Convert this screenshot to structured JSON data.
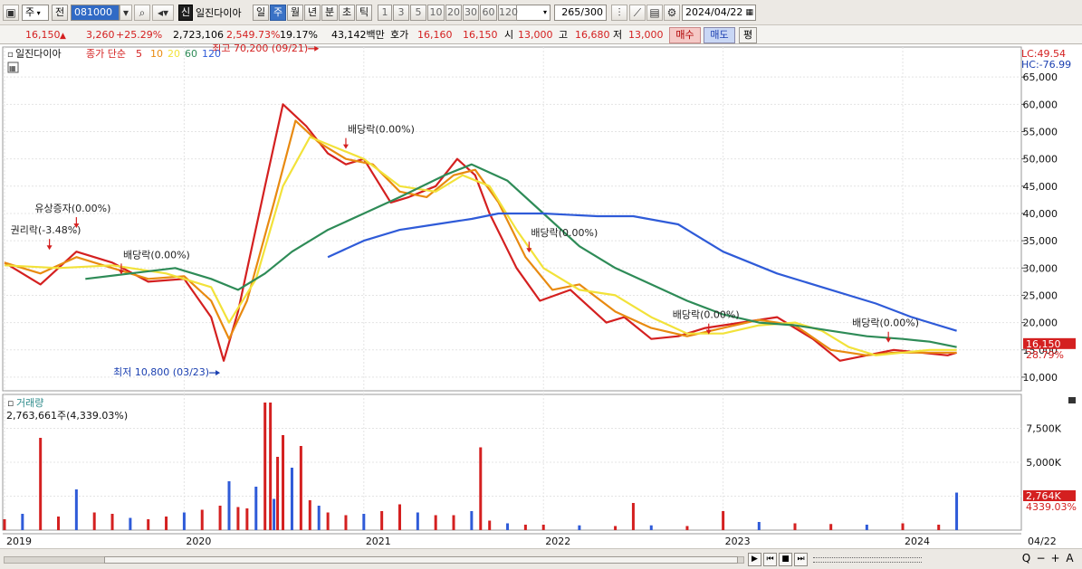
{
  "toolbar": {
    "period_type": "주",
    "mode": "전",
    "code": "081000",
    "stock_name": "일진다이아",
    "new_badge": "신",
    "timeframes": [
      "일",
      "주",
      "월",
      "년",
      "분",
      "초",
      "틱"
    ],
    "active_timeframe": "주",
    "periods": [
      "1",
      "3",
      "5",
      "10",
      "20",
      "30",
      "60",
      "120"
    ],
    "count": "265",
    "count_total": "/300",
    "date": "2024/04/22"
  },
  "quote": {
    "price": "16,150",
    "change": "3,260",
    "change_pct": "+25.29%",
    "volume": "2,723,106",
    "volume_ratio": "2,549.73%",
    "turnover": "19.17%",
    "amount": "43,142백만",
    "ask_label": "호가",
    "ask": "16,160",
    "bid": "16,150",
    "open_label": "시",
    "open": "13,000",
    "high_label": "고",
    "high": "16,680",
    "low_label": "저",
    "low": "13,000",
    "buy_label": "매수",
    "sell_label": "매도",
    "eval_label": "평"
  },
  "chart_data": {
    "type": "line",
    "title": "일진다이아",
    "legend": {
      "price_label": "종가 단순",
      "ma_periods": [
        "5",
        "10",
        "20",
        "60",
        "120"
      ],
      "ma_colors": [
        "#d42020",
        "#e88a10",
        "#f2e23a",
        "#2e8b57",
        "#2f5bd8"
      ]
    },
    "x_labels": [
      "2019",
      "2020",
      "2021",
      "2022",
      "2023",
      "2024",
      "04/22"
    ],
    "y_ticks": [
      "65,000",
      "60,000",
      "55,000",
      "50,000",
      "45,000",
      "40,000",
      "35,000",
      "30,000",
      "25,000",
      "20,000",
      "15,000",
      "10,000"
    ],
    "ylim": [
      7500,
      70500
    ],
    "scale_info": [
      "LC:49.54",
      "HC:-76.99"
    ],
    "current_price_label": "16,150",
    "current_pct_label": "28.79%",
    "series": [
      {
        "name": "5",
        "color": "#d42020",
        "x": [
          2019.0,
          2019.2,
          2019.4,
          2019.6,
          2019.8,
          2020.0,
          2020.15,
          2020.22,
          2020.3,
          2020.45,
          2020.55,
          2020.68,
          2020.8,
          2020.9,
          2021.0,
          2021.15,
          2021.25,
          2021.4,
          2021.52,
          2021.62,
          2021.7,
          2021.85,
          2021.98,
          2022.15,
          2022.35,
          2022.45,
          2022.6,
          2022.75,
          2022.9,
          2023.1,
          2023.3,
          2023.5,
          2023.65,
          2023.8,
          2023.95,
          2024.1,
          2024.25,
          2024.3
        ],
        "values": [
          31000,
          27000,
          33000,
          31000,
          27500,
          28000,
          21000,
          13000,
          22000,
          45000,
          60000,
          56000,
          51000,
          49000,
          50000,
          42000,
          43000,
          45000,
          50000,
          47000,
          40000,
          30000,
          24000,
          26000,
          20000,
          21000,
          17000,
          17500,
          19000,
          20000,
          21000,
          17000,
          13000,
          14000,
          15000,
          14500,
          14000,
          14500
        ]
      },
      {
        "name": "10",
        "color": "#e88a10",
        "x": [
          2019.0,
          2019.2,
          2019.4,
          2019.6,
          2019.8,
          2020.0,
          2020.15,
          2020.25,
          2020.35,
          2020.5,
          2020.62,
          2020.75,
          2020.9,
          2021.05,
          2021.2,
          2021.35,
          2021.5,
          2021.62,
          2021.75,
          2021.9,
          2022.05,
          2022.2,
          2022.4,
          2022.6,
          2022.8,
          2023.0,
          2023.2,
          2023.4,
          2023.6,
          2023.8,
          2023.95,
          2024.1,
          2024.3
        ],
        "values": [
          31000,
          29000,
          32000,
          30000,
          28000,
          28500,
          24000,
          17000,
          24000,
          42000,
          57000,
          53000,
          50000,
          49000,
          44000,
          43000,
          47000,
          48000,
          42000,
          32000,
          26000,
          27000,
          22000,
          19000,
          17500,
          19000,
          20500,
          19500,
          15000,
          14000,
          14500,
          14500,
          14500
        ]
      },
      {
        "name": "20",
        "color": "#f2e23a",
        "x": [
          2019.0,
          2019.3,
          2019.6,
          2019.9,
          2020.15,
          2020.25,
          2020.4,
          2020.55,
          2020.7,
          2020.85,
          2021.0,
          2021.2,
          2021.4,
          2021.55,
          2021.7,
          2021.85,
          2022.0,
          2022.2,
          2022.4,
          2022.6,
          2022.8,
          2023.0,
          2023.2,
          2023.4,
          2023.55,
          2023.7,
          2023.85,
          2024.0,
          2024.15,
          2024.3
        ],
        "values": [
          30500,
          30000,
          30500,
          29000,
          26500,
          20000,
          28000,
          45000,
          54000,
          52000,
          50000,
          45000,
          44000,
          47000,
          45000,
          37000,
          30000,
          26000,
          25000,
          21000,
          18000,
          18000,
          19500,
          20000,
          18500,
          15500,
          14000,
          14500,
          15000,
          15000
        ]
      },
      {
        "name": "60",
        "color": "#2e8b57",
        "x": [
          2019.45,
          2019.7,
          2019.95,
          2020.15,
          2020.3,
          2020.45,
          2020.6,
          2020.8,
          2021.0,
          2021.2,
          2021.45,
          2021.6,
          2021.8,
          2022.0,
          2022.2,
          2022.4,
          2022.6,
          2022.8,
          2023.0,
          2023.2,
          2023.4,
          2023.6,
          2023.8,
          2024.0,
          2024.15,
          2024.3
        ],
        "values": [
          28000,
          29000,
          30000,
          28000,
          26000,
          29000,
          33000,
          37000,
          40000,
          43000,
          47000,
          49000,
          46000,
          40000,
          34000,
          30000,
          27000,
          24000,
          21500,
          20000,
          19500,
          18500,
          17500,
          17000,
          16500,
          15500
        ]
      },
      {
        "name": "120",
        "color": "#2f5bd8",
        "x": [
          2020.8,
          2021.0,
          2021.2,
          2021.4,
          2021.6,
          2021.75,
          2022.0,
          2022.3,
          2022.5,
          2022.75,
          2023.0,
          2023.3,
          2023.6,
          2023.85,
          2024.05,
          2024.3
        ],
        "values": [
          32000,
          35000,
          37000,
          38000,
          39000,
          40000,
          40000,
          39500,
          39500,
          38000,
          33000,
          29000,
          26000,
          23500,
          21000,
          18500
        ]
      }
    ],
    "annotations": [
      {
        "text": "최고 70,200 (09/21)",
        "color": "#d42020"
      },
      {
        "text": "최저 10,800 (03/23)",
        "color": "#1a3fb0"
      },
      {
        "text": "유상증자(0.00%)",
        "color": "#222"
      },
      {
        "text": "권리락(-3.48%)",
        "color": "#222"
      },
      {
        "text": "배당락(0.00%)",
        "color": "#222"
      },
      {
        "text": "배당락(0.00%)",
        "color": "#222"
      },
      {
        "text": "배당락(0.00%)",
        "color": "#222"
      },
      {
        "text": "배당락(0.00%)",
        "color": "#222"
      },
      {
        "text": "배당락(0.00%)",
        "color": "#222"
      }
    ],
    "volume_panel": {
      "title": "거래량",
      "value_text": "2,763,661주(4,339.03%)",
      "y_ticks": [
        "7,500K",
        "5,000K",
        "2,500K"
      ],
      "ylim": [
        0,
        10000
      ],
      "current_label": "2,764K",
      "current_pct": "4339.03%",
      "x": [
        2019.0,
        2019.1,
        2019.2,
        2019.3,
        2019.4,
        2019.5,
        2019.6,
        2019.7,
        2019.8,
        2019.9,
        2020.0,
        2020.1,
        2020.2,
        2020.25,
        2020.3,
        2020.35,
        2020.4,
        2020.45,
        2020.48,
        2020.5,
        2020.52,
        2020.55,
        2020.6,
        2020.65,
        2020.7,
        2020.75,
        2020.8,
        2020.9,
        2021.0,
        2021.1,
        2021.2,
        2021.3,
        2021.4,
        2021.5,
        2021.6,
        2021.65,
        2021.7,
        2021.8,
        2021.9,
        2022.0,
        2022.2,
        2022.4,
        2022.5,
        2022.6,
        2022.8,
        2023.0,
        2023.2,
        2023.4,
        2023.6,
        2023.8,
        2024.0,
        2024.2,
        2024.3
      ],
      "values": [
        800,
        1200,
        6800,
        1000,
        3000,
        1300,
        1200,
        900,
        800,
        1000,
        1300,
        1500,
        1800,
        3600,
        1700,
        1600,
        3200,
        9400,
        9400,
        2300,
        5400,
        7000,
        4600,
        6200,
        2200,
        1800,
        1300,
        1100,
        1200,
        1400,
        1900,
        1300,
        1100,
        1100,
        1400,
        6100,
        700,
        500,
        400,
        400,
        350,
        300,
        2000,
        350,
        300,
        1400,
        600,
        500,
        450,
        400,
        500,
        400,
        2764
      ]
    }
  },
  "bottom": {
    "nav_buttons": [
      "▶",
      "⏮",
      "■",
      "⏭"
    ],
    "zoom_buttons": [
      "Q",
      "−",
      "+",
      "A"
    ]
  }
}
